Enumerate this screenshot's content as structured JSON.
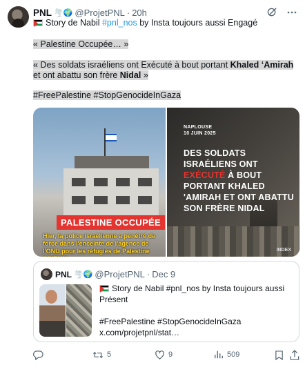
{
  "author": {
    "name": "PNL",
    "badges": "🌪️🌍",
    "handle": "@ProjetPNL",
    "time": "20h"
  },
  "post": {
    "line1_prefix": "Story de Nabil ",
    "line1_link": "#pnl_nos",
    "line1_suffix": " by Insta toujours aussi Engagé",
    "p1": "« Palestine Occupée… »",
    "p2": "« Des soldats israéliens ont Exécuté à bout portant Khaled ‘Amirah et ont abattu son frère Nidal »",
    "hashtags": "#FreePalestine #StopGenocideInGaza"
  },
  "media": {
    "left_banner": "PALESTINE OCCUPÉE",
    "left_caption_a": "Hier, la police israélienne a pénétré de force dans l'enceinte de l'agence de l'ONU pour les réfugiés de Palestine (UNRWA…",
    "right_date_place": "NAPLOUSE",
    "right_date": "10 JUIN 2025",
    "right_headline_a": "DES SOLDATS ISRAÉLIENS ONT ",
    "right_headline_red": "EXÉCUTÉ",
    "right_headline_b": " À BOUT PORTANT KHALED 'AMIRAH ET ONT ABATTU SON FRÈRE NIDAL",
    "right_watermark": "INDEX"
  },
  "quote": {
    "name": "PNL",
    "badges": "🌪️🌍",
    "handle": "@ProjetPNL",
    "time": "Dec 9",
    "line1": "Story de Nabil #pnl_nos by Insta toujours aussi Présent",
    "hashtags": "#FreePalestine #StopGenocideInGaza",
    "link": "x.com/projetpnl/stat…"
  },
  "actions": {
    "retweets": "5",
    "likes": "9",
    "views": "509"
  }
}
